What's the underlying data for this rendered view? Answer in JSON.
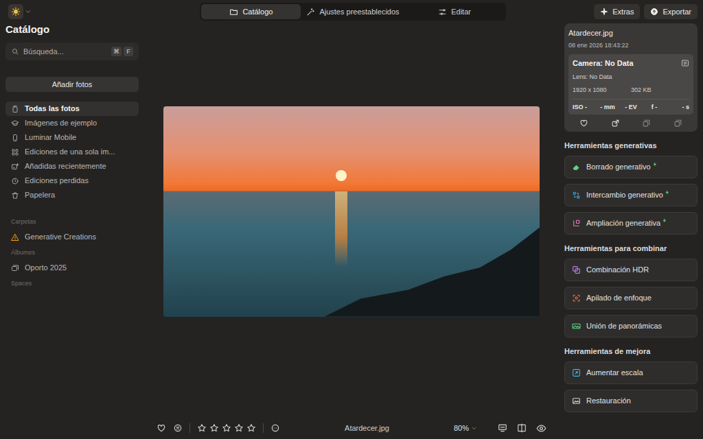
{
  "top_bar": {
    "tabs": [
      {
        "label": "Catálogo",
        "selected": true
      },
      {
        "label": "Ajustes preestablecidos",
        "selected": false
      },
      {
        "label": "Editar",
        "selected": false
      }
    ],
    "buttons": [
      "Extras",
      "Exportar"
    ]
  },
  "sidebar": {
    "title": "Catálogo",
    "search": {
      "placeholder": "Búsqueda...",
      "keys": [
        "⌘",
        "F"
      ]
    },
    "add_button": "Añadir fotos",
    "items": [
      {
        "label": "Todas las fotos",
        "selected": true
      },
      {
        "label": "Imágenes de ejemplo",
        "selected": false
      },
      {
        "label": "Luminar Mobile",
        "selected": false
      },
      {
        "label": "Ediciones de una sola im...",
        "selected": false
      },
      {
        "label": "Añadidas recientemente",
        "selected": false
      },
      {
        "label": "Ediciones perdidas",
        "selected": false
      },
      {
        "label": "Papelera",
        "selected": false
      }
    ],
    "sections": [
      {
        "title": "Carpetas",
        "items": [
          {
            "label": "Generative Creations",
            "selected": false
          }
        ]
      },
      {
        "title": "Álbumes",
        "items": [
          {
            "label": "Oporto 2025",
            "selected": false
          }
        ]
      },
      {
        "title": "Spaces",
        "items": []
      }
    ]
  },
  "info": {
    "filename": "Atardecer.jpg",
    "date": "08 ene 2026 18:43:22",
    "camera": "Camera: No Data",
    "lens": "Lens: No Data",
    "resolution": "1920 x 1080",
    "size": "302 KB",
    "exif": [
      "ISO -",
      "- mm",
      "- EV",
      "f -",
      "- s"
    ],
    "favorite": false
  },
  "tool_groups": [
    {
      "title": "Herramientas generativas",
      "tools": [
        {
          "label": "Borrado generativo",
          "generative": true,
          "color": "#5fd48a"
        },
        {
          "label": "Intercambio generativo",
          "generative": true,
          "color": "#3fb4e8"
        },
        {
          "label": "Ampliación generativa",
          "generative": true,
          "color": "#e879c6"
        }
      ]
    },
    {
      "title": "Herramientas para combinar",
      "tools": [
        {
          "label": "Combinación HDR",
          "generative": false,
          "color": "#b77ff0"
        },
        {
          "label": "Apilado de enfoque",
          "generative": false,
          "color": "#f0704a"
        },
        {
          "label": "Unión de panorámicas",
          "generative": false,
          "color": "#5fd48a"
        }
      ]
    },
    {
      "title": "Herramientas de mejora",
      "tools": [
        {
          "label": "Aumentar escala",
          "generative": false,
          "color": "#3fb4e8"
        },
        {
          "label": "Restauración",
          "generative": false,
          "color": "#d4d4d4"
        }
      ]
    }
  ],
  "bottom_bar": {
    "favorite": false,
    "rejected": false,
    "stars": 0,
    "filename": "Atardecer.jpg",
    "zoom": "80%"
  }
}
